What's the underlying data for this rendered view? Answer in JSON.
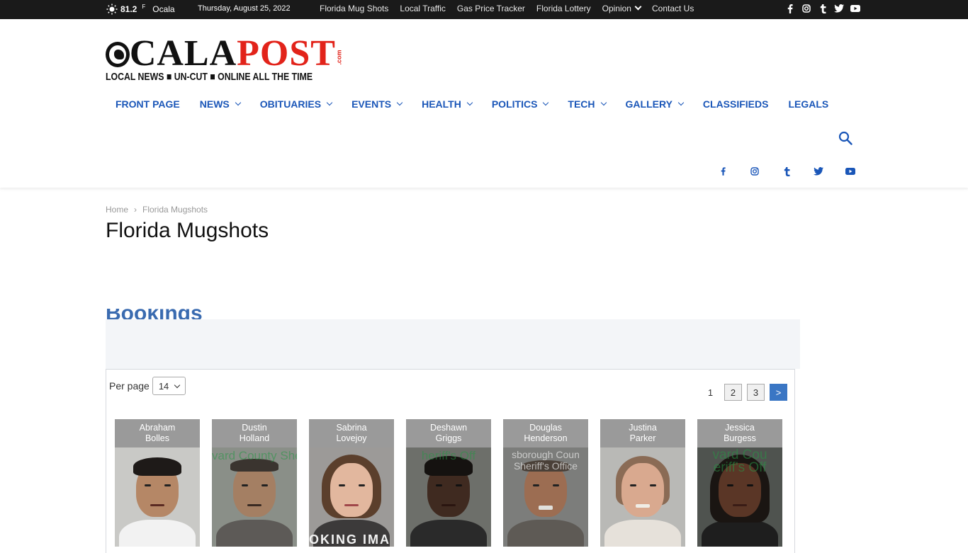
{
  "topbar": {
    "temperature": "81.2",
    "unit": "F",
    "city": "Ocala",
    "date": "Thursday, August 25, 2022",
    "links": [
      "Florida Mug Shots",
      "Local Traffic",
      "Gas Price Tracker",
      "Florida Lottery",
      "Opinion",
      "Contact Us"
    ],
    "social_icons": [
      "facebook-icon",
      "instagram-icon",
      "tumblr-icon",
      "twitter-icon",
      "youtube-icon"
    ]
  },
  "logo": {
    "word1": "CALA",
    "word2": "POST",
    "domain": ".com",
    "tagline": "LOCAL NEWS  ■  UN-CUT  ■  ONLINE ALL THE TIME"
  },
  "nav": {
    "items": [
      {
        "label": "FRONT PAGE",
        "dropdown": false
      },
      {
        "label": "NEWS",
        "dropdown": true
      },
      {
        "label": "OBITUARIES",
        "dropdown": true
      },
      {
        "label": "EVENTS",
        "dropdown": true
      },
      {
        "label": "HEALTH",
        "dropdown": true
      },
      {
        "label": "POLITICS",
        "dropdown": true
      },
      {
        "label": "TECH",
        "dropdown": true
      },
      {
        "label": "GALLERY",
        "dropdown": true
      },
      {
        "label": "CLASSIFIEDS",
        "dropdown": false
      },
      {
        "label": "LEGALS",
        "dropdown": false
      }
    ]
  },
  "breadcrumb": {
    "home": "Home",
    "separator": "›",
    "current": "Florida Mugshots"
  },
  "page_title": "Florida Mugshots",
  "widget": {
    "heading": "Bookings",
    "per_page_label": "Per page",
    "per_page_value": "14",
    "pagination": {
      "current": "1",
      "pages": [
        "2",
        "3"
      ],
      "next": ">"
    },
    "mugshots": [
      {
        "first": "Abraham",
        "last": "Bolles"
      },
      {
        "first": "Dustin",
        "last": "Holland",
        "overlay": "vard County Sheriff's Offi"
      },
      {
        "first": "Sabrina",
        "last": "Lovejoy",
        "overlay_bottom": "OKING IMA"
      },
      {
        "first": "Deshawn",
        "last": "Griggs",
        "overlay": "heriff's Off"
      },
      {
        "first": "Douglas",
        "last": "Henderson",
        "overlay": "sborough Coun Sheriff's Office"
      },
      {
        "first": "Justina",
        "last": "Parker"
      },
      {
        "first": "Jessica",
        "last": "Burgess",
        "overlay": "vard Cou eriff's Off"
      }
    ]
  },
  "colors": {
    "topbar_bg": "#1a1a1a",
    "nav_blue": "#1a56b8",
    "logo_red": "#e2231a",
    "pager_active": "#3a76c4"
  }
}
